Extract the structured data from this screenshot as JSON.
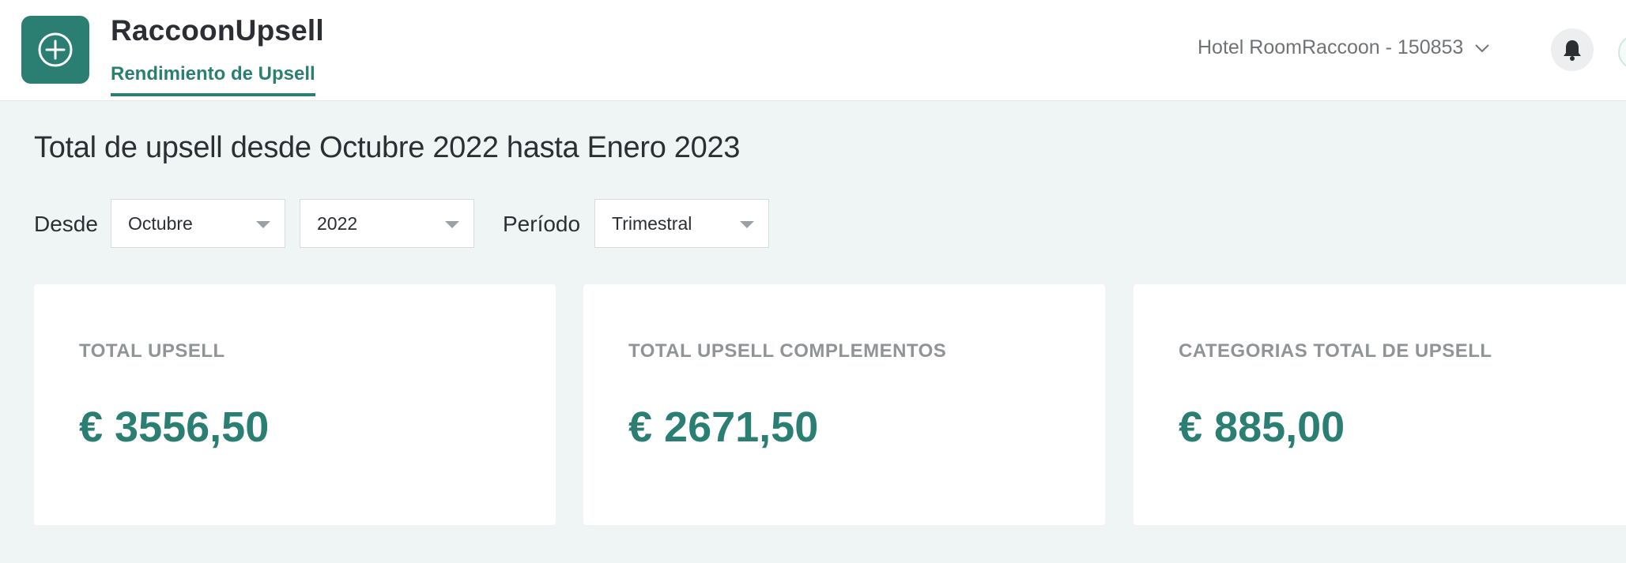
{
  "app": {
    "title": "RaccoonUpsell",
    "active_tab": "Rendimiento de Upsell",
    "logo_icon": "plus-circle-icon"
  },
  "header": {
    "hotel": "Hotel RoomRaccoon - 150853",
    "notifications_icon": "bell-icon"
  },
  "page": {
    "heading": "Total de upsell desde Octubre 2022 hasta Enero 2023"
  },
  "filters": {
    "from_label": "Desde",
    "month": "Octubre",
    "year": "2022",
    "period_label": "Período",
    "period": "Trimestral"
  },
  "cards": [
    {
      "label": "TOTAL UPSELL",
      "value": "€ 3556,50"
    },
    {
      "label": "TOTAL UPSELL COMPLEMENTOS",
      "value": "€ 2671,50"
    },
    {
      "label": "CATEGORIAS TOTAL DE UPSELL",
      "value": "€ 885,00"
    }
  ],
  "colors": {
    "accent": "#2a7f72",
    "background": "#eff4f4",
    "card": "#ffffff",
    "muted": "#8f9497"
  }
}
